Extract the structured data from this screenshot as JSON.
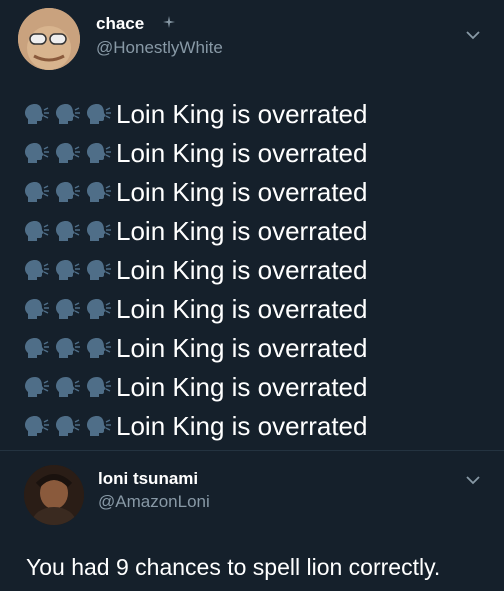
{
  "tweet1": {
    "name": "chace",
    "handle": "@HonestlyWhite",
    "lines": [
      "Loin King is overrated",
      "Loin King is overrated",
      "Loin King is overrated",
      "Loin King is overrated",
      "Loin King is overrated",
      "Loin King is overrated",
      "Loin King is overrated",
      "Loin King is overrated",
      "Loin King is overrated"
    ],
    "line_icon": "speaking-head-icon"
  },
  "tweet2": {
    "name": "loni tsunami",
    "handle": "@AmazonLoni",
    "text": "You had 9 chances to spell lion correctly."
  },
  "colors": {
    "background": "#15202b",
    "text": "#ffffff",
    "secondary": "#8899a6",
    "emoji": "#4f6e88"
  }
}
